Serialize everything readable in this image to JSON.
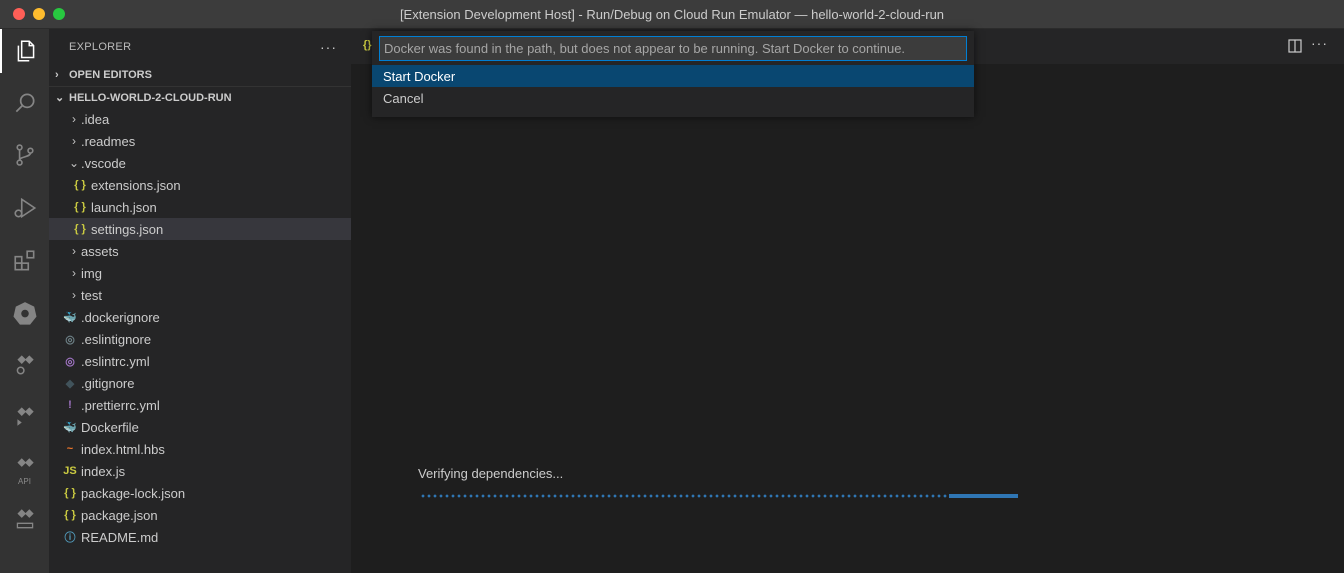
{
  "window": {
    "title": "[Extension Development Host] - Run/Debug on Cloud Run Emulator — hello-world-2-cloud-run"
  },
  "activity_bar": {
    "items": [
      {
        "name": "explorer-icon"
      },
      {
        "name": "search-icon"
      },
      {
        "name": "source-control-icon"
      },
      {
        "name": "run-debug-icon"
      },
      {
        "name": "extensions-icon"
      },
      {
        "name": "kubernetes-icon"
      },
      {
        "name": "cloud-code-icon"
      },
      {
        "name": "cloud-run-icon"
      },
      {
        "name": "cloud-apis-icon",
        "label": "API"
      },
      {
        "name": "secret-manager-icon"
      }
    ]
  },
  "sidebar": {
    "title": "EXPLORER",
    "more": "···",
    "open_editors": "OPEN EDITORS",
    "project": "HELLO-WORLD-2-CLOUD-RUN",
    "tree": [
      {
        "label": ".idea",
        "type": "folder",
        "expanded": false,
        "indent": 1
      },
      {
        "label": ".readmes",
        "type": "folder",
        "expanded": false,
        "indent": 1
      },
      {
        "label": ".vscode",
        "type": "folder",
        "expanded": true,
        "indent": 1
      },
      {
        "label": "extensions.json",
        "type": "json",
        "indent": 2
      },
      {
        "label": "launch.json",
        "type": "json",
        "indent": 2
      },
      {
        "label": "settings.json",
        "type": "json",
        "indent": 2,
        "selected": true
      },
      {
        "label": "assets",
        "type": "folder",
        "expanded": false,
        "indent": 1
      },
      {
        "label": "img",
        "type": "folder",
        "expanded": false,
        "indent": 1
      },
      {
        "label": "test",
        "type": "folder",
        "expanded": false,
        "indent": 1
      },
      {
        "label": ".dockerignore",
        "type": "dockerignore",
        "indent": 1
      },
      {
        "label": ".eslintignore",
        "type": "eslintignore",
        "indent": 1
      },
      {
        "label": ".eslintrc.yml",
        "type": "eslintrc",
        "indent": 1
      },
      {
        "label": ".gitignore",
        "type": "git",
        "indent": 1
      },
      {
        "label": ".prettierrc.yml",
        "type": "prettier",
        "indent": 1
      },
      {
        "label": "Dockerfile",
        "type": "docker",
        "indent": 1
      },
      {
        "label": "index.html.hbs",
        "type": "hbs",
        "indent": 1
      },
      {
        "label": "index.js",
        "type": "js",
        "indent": 1
      },
      {
        "label": "package-lock.json",
        "type": "json",
        "indent": 1
      },
      {
        "label": "package.json",
        "type": "json",
        "indent": 1
      },
      {
        "label": "README.md",
        "type": "info",
        "indent": 1
      }
    ]
  },
  "quick_pick": {
    "placeholder": "Docker was found in the path, but does not appear to be running. Start Docker to continue.",
    "items": [
      {
        "label": "Start Docker",
        "active": true
      },
      {
        "label": "Cancel",
        "active": false
      }
    ]
  },
  "progress": {
    "label": "Verifying dependencies...",
    "fraction": 0.885
  },
  "colors": {
    "accent": "#007fd4",
    "selection": "#094771",
    "progress": "#2f76b4",
    "json_icon": "#cbcb41"
  }
}
